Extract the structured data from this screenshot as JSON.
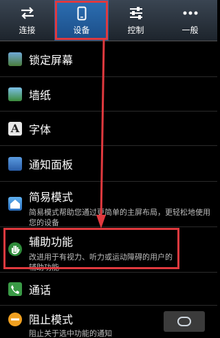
{
  "tabs": [
    {
      "label": "连接",
      "icon": "connections-icon"
    },
    {
      "label": "设备",
      "icon": "phone-icon",
      "active": true
    },
    {
      "label": "控制",
      "icon": "sliders-icon"
    },
    {
      "label": "一般",
      "icon": "more-icon"
    }
  ],
  "items": [
    {
      "title": "锁定屏幕",
      "icon": "lock-screen-icon"
    },
    {
      "title": "墙纸",
      "icon": "wallpaper-icon"
    },
    {
      "title": "字体",
      "icon": "font-icon"
    },
    {
      "title": "通知面板",
      "icon": "notification-panel-icon"
    },
    {
      "title": "简易模式",
      "subtitle": "简易模式帮助您通过更简单的主屏布局，更轻松地使用您的设备",
      "icon": "home-icon"
    },
    {
      "title": "辅助功能",
      "subtitle": "改进用于有视力、听力或运动障碍的用户的辅助功能",
      "icon": "accessibility-hand-icon"
    },
    {
      "title": "通话",
      "icon": "call-icon"
    },
    {
      "title": "阻止模式",
      "subtitle": "阻止关于选中功能的通知",
      "icon": "block-icon"
    }
  ],
  "colors": {
    "highlight": "#e0393e",
    "tab_active": "#1b4d87"
  }
}
